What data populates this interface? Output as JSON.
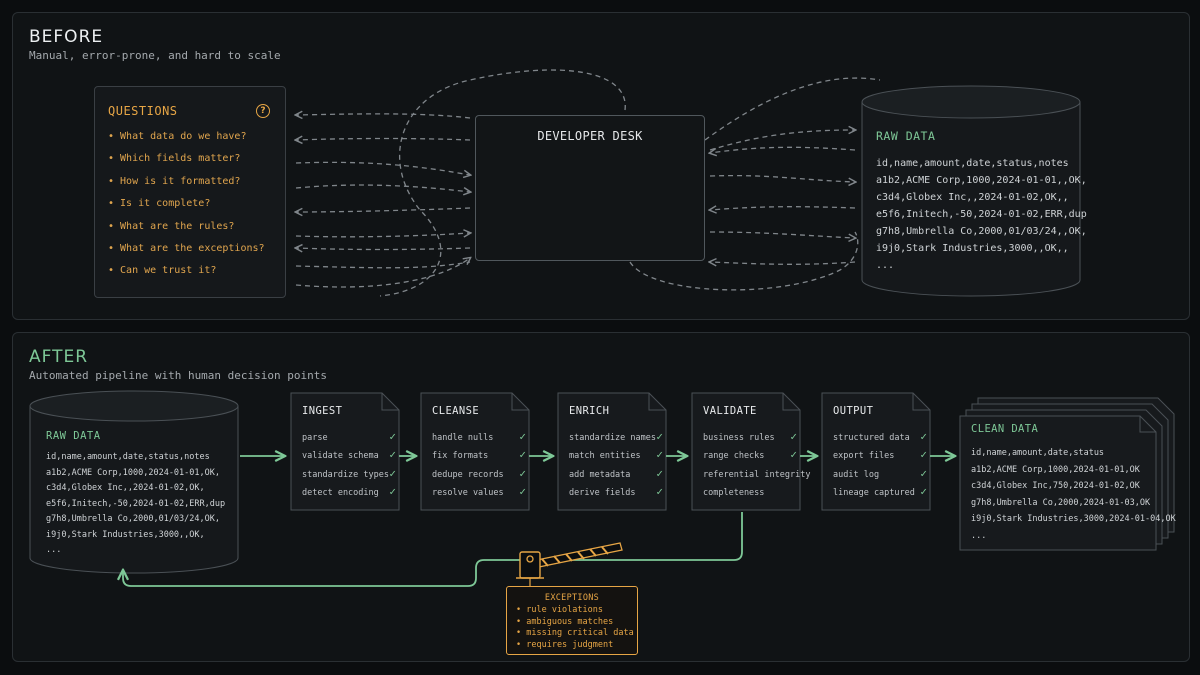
{
  "before": {
    "title": "BEFORE",
    "subtitle": "Manual, error-prone, and hard to scale",
    "questions": {
      "title": "QUESTIONS",
      "help_icon": "question-circle-icon",
      "items": [
        "• What data do we have?",
        "• Which fields matter?",
        "• How is it formatted?",
        "• Is it complete?",
        "• What are the rules?",
        "• What are the exceptions?",
        "• Can we trust it?"
      ]
    },
    "desk": {
      "title": "DEVELOPER DESK",
      "illustration": "developer-desk-icon"
    },
    "raw_data": {
      "title": "RAW DATA",
      "rows": [
        "id,name,amount,date,status,notes",
        "a1b2,ACME Corp,1000,2024-01-01,,OK,",
        "c3d4,Globex Inc,,2024-01-02,OK,,",
        "e5f6,Initech,-50,2024-01-02,ERR,dup",
        "g7h8,Umbrella Co,2000,01/03/24,,OK,",
        "i9j0,Stark Industries,3000,,OK,,",
        "..."
      ]
    }
  },
  "after": {
    "title": "AFTER",
    "subtitle": "Automated pipeline with human decision points",
    "raw_data": {
      "title": "RAW DATA",
      "rows": [
        "id,name,amount,date,status,notes",
        "a1b2,ACME Corp,1000,2024-01-01,OK,",
        "c3d4,Globex Inc,,2024-01-02,OK,",
        "e5f6,Initech,-50,2024-01-02,ERR,dup",
        "g7h8,Umbrella Co,2000,01/03/24,OK,",
        "i9j0,Stark Industries,3000,,OK,",
        "..."
      ]
    },
    "stages": [
      {
        "title": "INGEST",
        "items": [
          "parse",
          "validate schema",
          "standardize types",
          "detect encoding"
        ]
      },
      {
        "title": "CLEANSE",
        "items": [
          "handle nulls",
          "fix formats",
          "dedupe records",
          "resolve values"
        ]
      },
      {
        "title": "ENRICH",
        "items": [
          "standardize names",
          "match entities",
          "add metadata",
          "derive fields"
        ]
      },
      {
        "title": "VALIDATE",
        "items": [
          "business rules",
          "range checks",
          "referential integrity",
          "completeness"
        ]
      },
      {
        "title": "OUTPUT",
        "items": [
          "structured data",
          "export files",
          "audit log",
          "lineage captured"
        ]
      }
    ],
    "check_icon": "✓",
    "clean_data": {
      "title": "CLEAN DATA",
      "rows": [
        "id,name,amount,date,status",
        "a1b2,ACME Corp,1000,2024-01-01,OK",
        "c3d4,Globex Inc,750,2024-01-02,OK",
        "g7h8,Umbrella Co,2000,2024-01-03,OK",
        "i9j0,Stark Industries,3000,2024-01-04,OK",
        "..."
      ]
    },
    "exceptions": {
      "title": "EXCEPTIONS",
      "gate_icon": "barrier-gate-icon",
      "items": [
        "• rule violations",
        "• ambiguous matches",
        "• missing critical data",
        "• requires judgment"
      ]
    }
  },
  "colors": {
    "accent_green": "#7ec897",
    "accent_amber": "#e6a545",
    "panel_bg": "#101315",
    "border": "#2a2f33"
  }
}
